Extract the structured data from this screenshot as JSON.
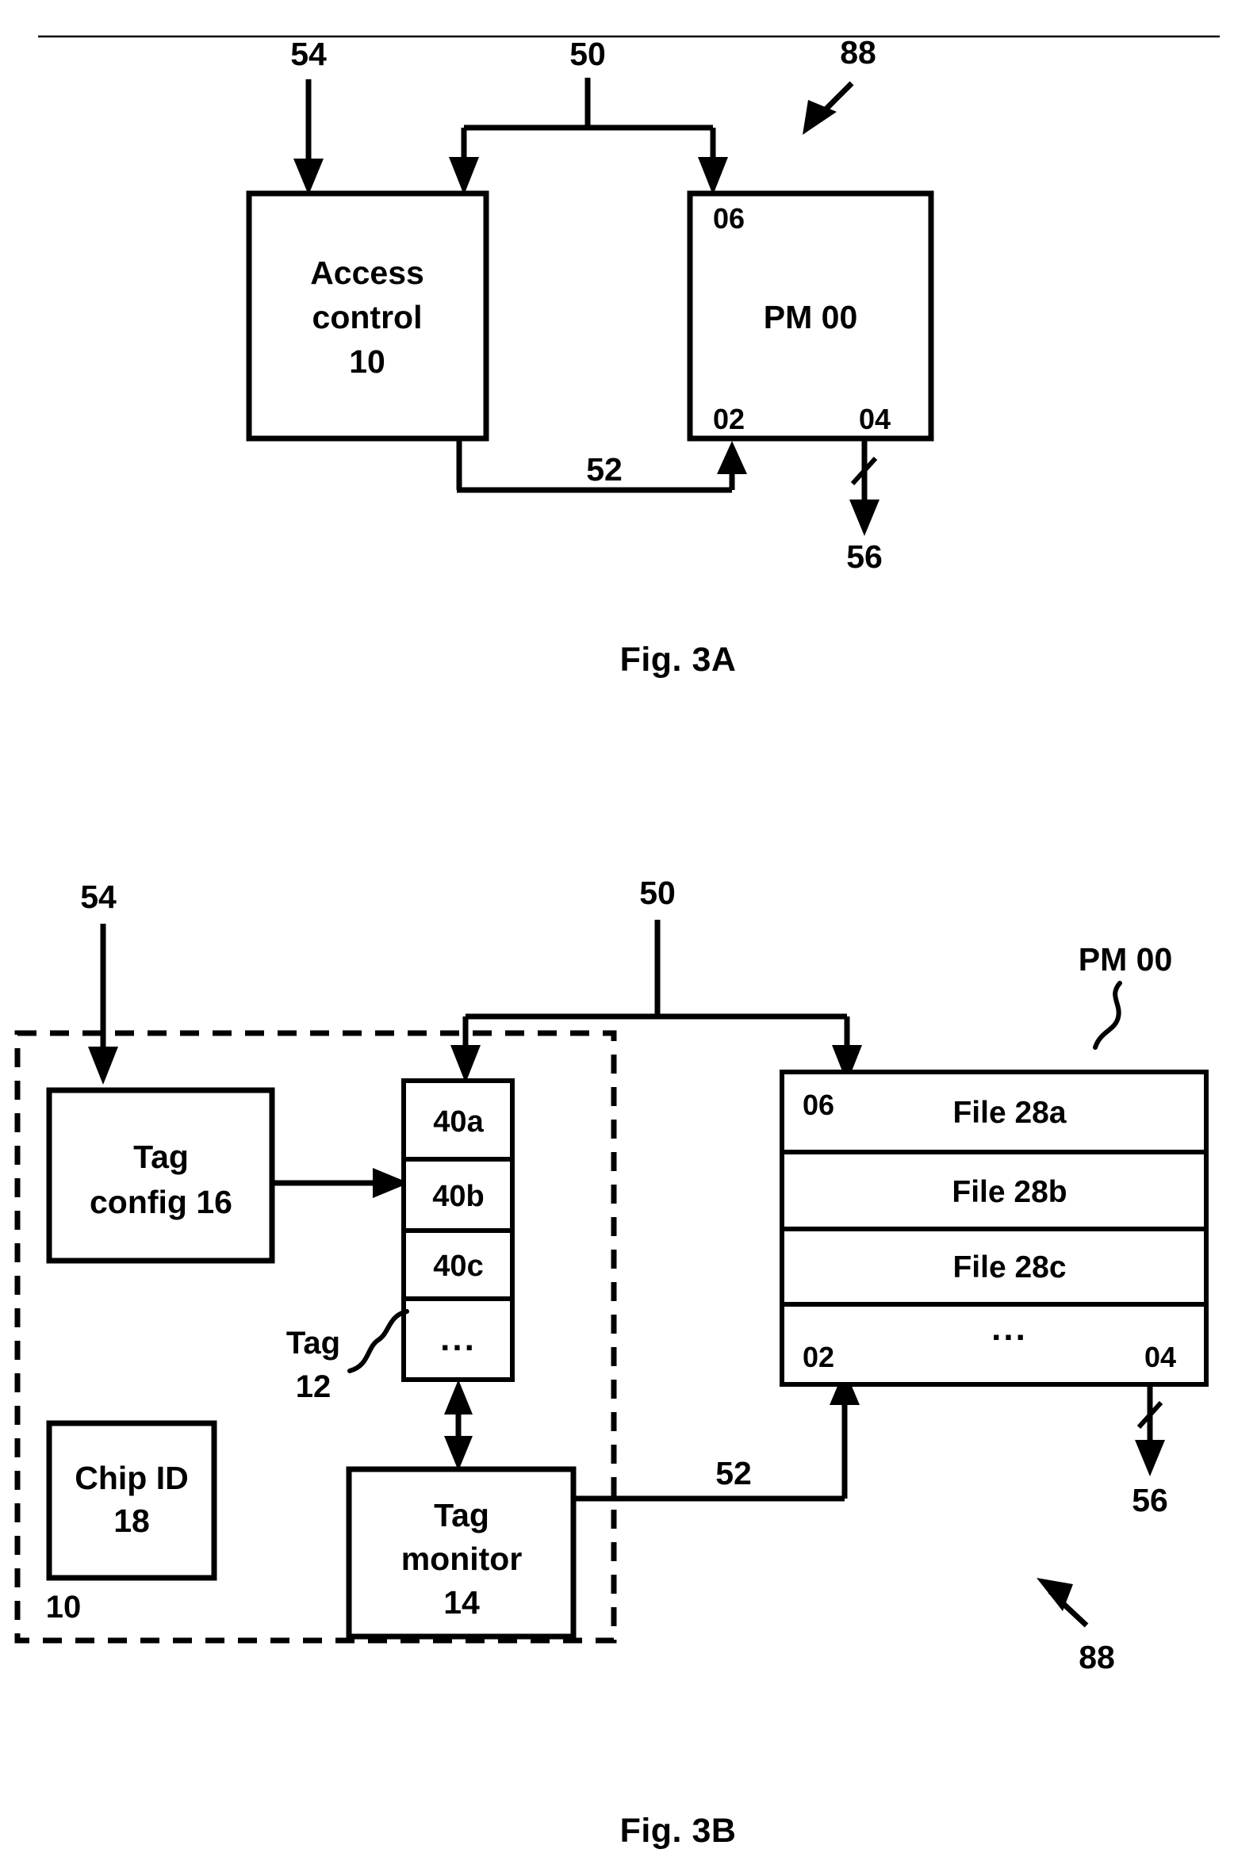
{
  "page": {
    "background": "#ffffff",
    "ink": "#000000"
  },
  "figures": [
    {
      "id": "fig-3a",
      "caption": "Fig. 3A",
      "overall_ref": "88",
      "blocks": [
        {
          "id": "access-control",
          "label_line1": "Access",
          "label_line2": "control",
          "label_line3": "10"
        },
        {
          "id": "pm-00",
          "label": "PM 00",
          "corner_top_left": "06",
          "corner_bottom_left": "02",
          "corner_bottom_right": "04"
        }
      ],
      "connector_refs": {
        "input_54": "54",
        "bus_50": "50",
        "feedback_52": "52",
        "output_56": "56"
      }
    },
    {
      "id": "fig-3b",
      "caption": "Fig. 3B",
      "overall_ref": "88",
      "access_control_ref": "10",
      "blocks": [
        {
          "id": "tag-config",
          "label_line1": "Tag",
          "label_line2": "config 16"
        },
        {
          "id": "chip-id",
          "label_line1": "Chip ID",
          "label_line2": "18"
        },
        {
          "id": "tag-monitor",
          "label_line1": "Tag",
          "label_line2": "monitor",
          "label_line3": "14"
        }
      ],
      "tag_register": {
        "leader_label_line1": "Tag",
        "leader_label_line2": "12",
        "cells": [
          "40a",
          "40b",
          "40c",
          "..."
        ]
      },
      "pm_table": {
        "title": "PM 00",
        "corner_top_left": "06",
        "corner_bottom_left": "02",
        "corner_bottom_right": "04",
        "rows": [
          "File 28a",
          "File 28b",
          "File 28c",
          "..."
        ]
      },
      "connector_refs": {
        "input_54": "54",
        "bus_50": "50",
        "feedback_52": "52",
        "output_56": "56"
      }
    }
  ]
}
